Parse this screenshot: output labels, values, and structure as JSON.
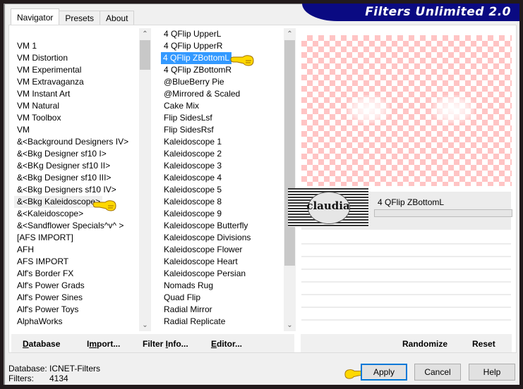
{
  "window": {
    "title": "Filters Unlimited 2.0"
  },
  "tabs": [
    {
      "label": "Navigator",
      "active": true
    },
    {
      "label": "Presets",
      "active": false
    },
    {
      "label": "About",
      "active": false
    }
  ],
  "categories": {
    "items": [
      "VM 1",
      "VM Distortion",
      "VM Experimental",
      "VM Extravaganza",
      "VM Instant Art",
      "VM Natural",
      "VM Toolbox",
      "VM",
      "&<Background Designers IV>",
      "&<Bkg Designer sf10 I>",
      "&<BKg Designer sf10 II>",
      "&<Bkg Designer sf10 III>",
      "&<Bkg Designers sf10 IV>",
      "&<Bkg Kaleidoscope>",
      "&<Kaleidoscope>",
      "&<Sandflower Specials^v^ >",
      "[AFS IMPORT]",
      "AFH",
      "AFS IMPORT",
      "Alf's Border FX",
      "Alf's Power Grads",
      "Alf's Power Sines",
      "Alf's Power Toys",
      "AlphaWorks"
    ],
    "selected": "&<Bkg Kaleidoscope>"
  },
  "filters": {
    "items": [
      "4 QFlip UpperL",
      "4 QFlip UpperR",
      "4 QFlip ZBottomL",
      "4 QFlip ZBottomR",
      "@BlueBerry Pie",
      "@Mirrored & Scaled",
      "Cake Mix",
      "Flip SidesLsf",
      "Flip SidesRsf",
      "Kaleidoscope 1",
      "Kaleidoscope 2",
      "Kaleidoscope 3",
      "Kaleidoscope 4",
      "Kaleidoscope 5",
      "Kaleidoscope 8",
      "Kaleidoscope 9",
      "Kaleidoscope Butterfly",
      "Kaleidoscope Divisions",
      "Kaleidoscope Flower",
      "Kaleidoscope Heart",
      "Kaleidoscope Persian",
      "Nomads Rug",
      "Quad Flip",
      "Radial Mirror",
      "Radial Replicate"
    ],
    "selected": "4 QFlip ZBottomL"
  },
  "preview": {
    "filter_name": "4 QFlip ZBottomL",
    "logo_text": "claudia",
    "pattern_color": "#ffc4c4"
  },
  "left_buttons": {
    "database": {
      "pre": "",
      "u": "D",
      "post": "atabase"
    },
    "import": {
      "pre": "I",
      "u": "m",
      "post": "port..."
    },
    "filter_info": {
      "pre": "Filter ",
      "u": "I",
      "post": "nfo..."
    },
    "editor": {
      "pre": "",
      "u": "E",
      "post": "ditor..."
    }
  },
  "right_buttons": {
    "randomize": "Randomize",
    "reset": "Reset"
  },
  "status": {
    "database_label": "Database:",
    "database_value": "ICNET-Filters",
    "filters_label": "Filters:",
    "filters_value": "4134"
  },
  "dialog_buttons": {
    "apply": "Apply",
    "cancel": "Cancel",
    "help": "Help"
  },
  "colors": {
    "selection": "#3399ff",
    "banner": "#0a0a82",
    "default_button_border": "#0078d7"
  }
}
